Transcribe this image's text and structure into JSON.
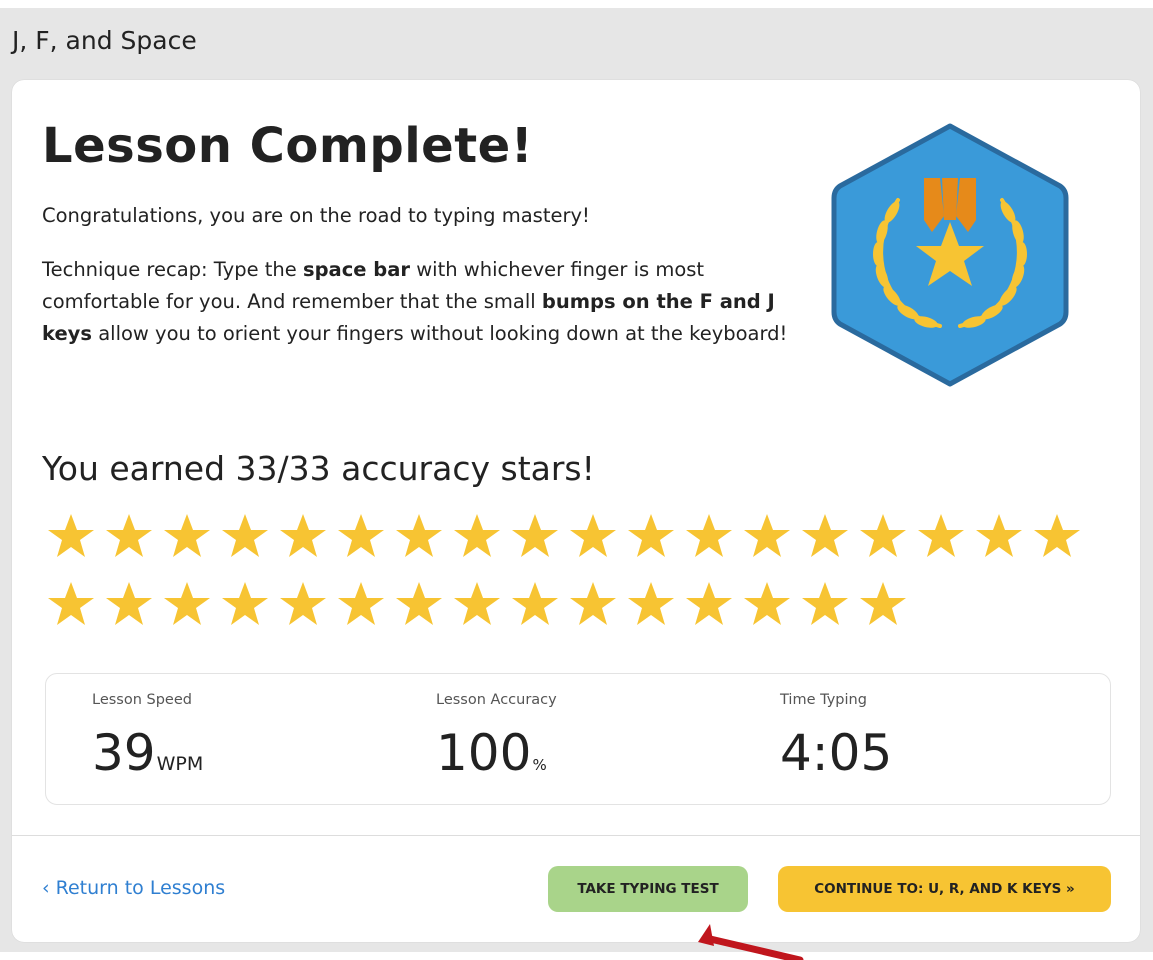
{
  "window": {
    "title": "J, F, and Space"
  },
  "lesson": {
    "title": "Lesson Complete!",
    "congrats": "Congratulations, you are on the road to typing mastery!",
    "recap": {
      "part1": "Technique recap: Type the ",
      "bold1": "space bar",
      "part2": " with whichever finger is most comfortable for you. And remember that the small ",
      "bold2": "bumps on the F and J keys",
      "part3": " allow you to orient your fingers without looking down at the keyboard!"
    }
  },
  "badge": {
    "icon": "medal-laurel-badge-icon",
    "colors": {
      "hex_fill": "#3a9ad9",
      "hex_border": "#2a6a9e",
      "laurel": "#f7c433",
      "ribbon": "#e68a1a",
      "star": "#f7c433"
    }
  },
  "stars": {
    "heading": "You earned 33/33 accuracy stars!",
    "earned": 33,
    "total": 33,
    "color": "#f7c433"
  },
  "stats": {
    "speed": {
      "label": "Lesson Speed",
      "value": "39",
      "unit": "WPM"
    },
    "accuracy": {
      "label": "Lesson Accuracy",
      "value": "100",
      "unit": "%"
    },
    "time": {
      "label": "Time Typing",
      "value": "4:05"
    }
  },
  "footer": {
    "return_label": "‹ Return to Lessons",
    "test_button": "TAKE TYPING TEST",
    "continue_button": "CONTINUE TO: U, R, AND K KEYS »",
    "link_color": "#2f7fd1",
    "test_color": "#a9d48a",
    "continue_color": "#f7c433"
  },
  "annotation": {
    "icon": "red-arrow-icon",
    "color": "#c0161d"
  }
}
